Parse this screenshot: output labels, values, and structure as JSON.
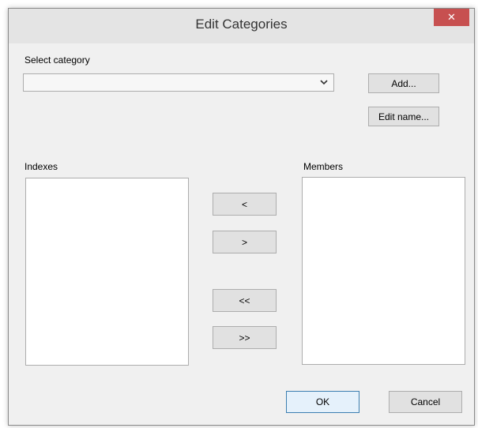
{
  "window": {
    "title": "Edit Categories",
    "close_glyph": "✕"
  },
  "category": {
    "label": "Select category",
    "selected_value": ""
  },
  "buttons": {
    "add": "Add...",
    "edit_name": "Edit name...",
    "move_left": "<",
    "move_right": ">",
    "move_all_left": "<<",
    "move_all_right": ">>",
    "ok": "OK",
    "cancel": "Cancel"
  },
  "indexes": {
    "label": "Indexes",
    "items": []
  },
  "members": {
    "label": "Members",
    "items": []
  },
  "colors": {
    "close_button": "#c75050",
    "dialog_bg": "#f0f0f0",
    "default_button_border": "#3c7fb1"
  },
  "icons": {
    "close": "close-icon",
    "dropdown": "chevron-down-icon"
  }
}
